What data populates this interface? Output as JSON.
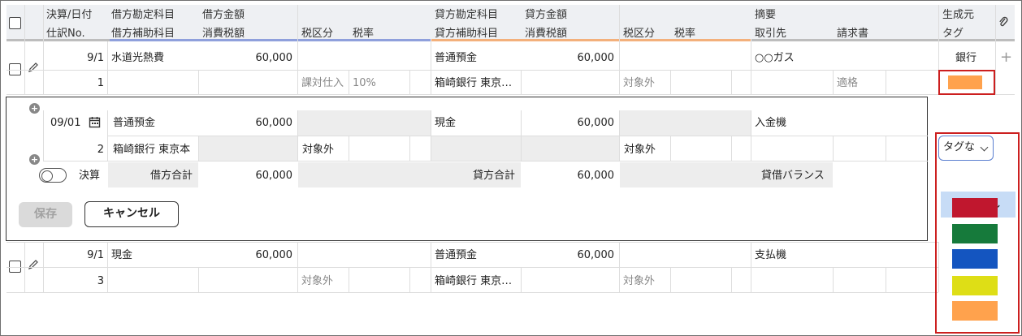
{
  "header": {
    "row1": [
      "決算/日付",
      "借方勘定科目",
      "借方金額",
      "貸方勘定科目",
      "貸方金額",
      "摘要",
      "生成元"
    ],
    "row2": [
      "仕訳No.",
      "借方補助科目",
      "消費税額",
      "税区分",
      "税率",
      "貸方補助科目",
      "消費税額",
      "税区分",
      "税率",
      "取引先",
      "請求書",
      "タグ"
    ]
  },
  "entry1": {
    "date": "9/1",
    "no": "1",
    "debit_account": "水道光熱費",
    "debit_amount": "60,000",
    "debit_tax_class": "課対仕入",
    "debit_tax_rate": "10%",
    "credit_account": "普通預金",
    "credit_sub": "箱崎銀行 東京…",
    "credit_amount": "60,000",
    "credit_tax_class": "対象外",
    "summary": "○○ガス",
    "invoice": "適格",
    "source": "銀行",
    "tag_color": "#ffa24d"
  },
  "edit": {
    "date": "09/01",
    "no": "2",
    "debit_account": "普通預金",
    "debit_sub": "箱崎銀行 東京本",
    "debit_amount": "60,000",
    "debit_tax_class": "対象外",
    "credit_account": "現金",
    "credit_amount": "60,000",
    "credit_tax_class": "対象外",
    "summary": "入金機",
    "kessan_label": "決算",
    "debit_total_label": "借方合計",
    "debit_total": "60,000",
    "credit_total_label": "貸方合計",
    "credit_total": "60,000",
    "balance_label": "貸借バランス",
    "save_label": "保存",
    "cancel_label": "キャンセル"
  },
  "tag_dropdown": {
    "selected": "タグな",
    "none_label": "タグなし",
    "colors": [
      "#c0172e",
      "#167a3b",
      "#1455c0",
      "#dede16",
      "#ffa24d"
    ]
  },
  "entry3": {
    "date": "9/1",
    "no": "3",
    "debit_account": "現金",
    "debit_amount": "60,000",
    "debit_tax_class": "対象外",
    "credit_account": "普通預金",
    "credit_sub": "箱崎銀行 東京…",
    "credit_amount": "60,000",
    "credit_tax_class": "対象外",
    "summary": "支払機"
  }
}
